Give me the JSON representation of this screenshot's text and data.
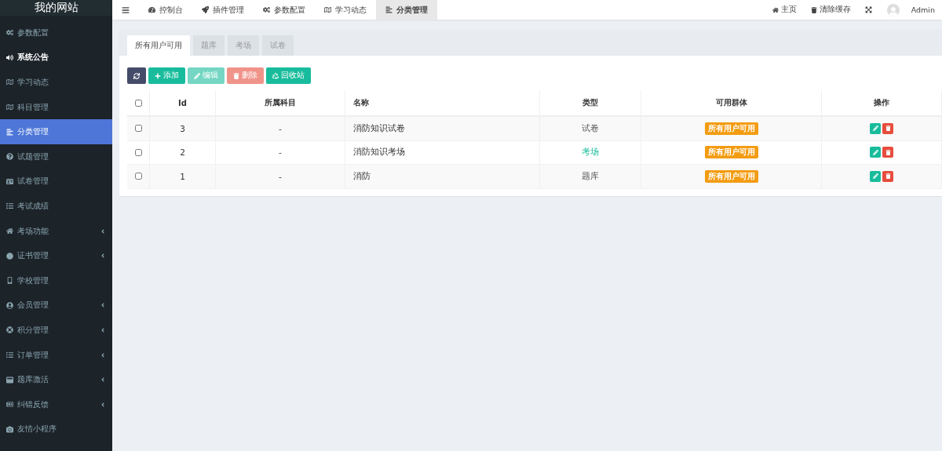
{
  "sidebar": {
    "title": "我的网站",
    "items": [
      {
        "label": "参数配置",
        "selected": false,
        "highlighted": false,
        "expandable": false
      },
      {
        "label": "系统公告",
        "selected": false,
        "highlighted": true,
        "expandable": false
      },
      {
        "label": "学习动态",
        "selected": false,
        "highlighted": false,
        "expandable": false
      },
      {
        "label": "科目管理",
        "selected": false,
        "highlighted": false,
        "expandable": false
      },
      {
        "label": "分类管理",
        "selected": true,
        "highlighted": false,
        "expandable": false
      },
      {
        "label": "试题管理",
        "selected": false,
        "highlighted": false,
        "expandable": false
      },
      {
        "label": "试卷管理",
        "selected": false,
        "highlighted": false,
        "expandable": false
      },
      {
        "label": "考试成绩",
        "selected": false,
        "highlighted": false,
        "expandable": false
      },
      {
        "label": "考场功能",
        "selected": false,
        "highlighted": false,
        "expandable": true
      },
      {
        "label": "证书管理",
        "selected": false,
        "highlighted": false,
        "expandable": true
      },
      {
        "label": "学校管理",
        "selected": false,
        "highlighted": false,
        "expandable": false
      },
      {
        "label": "会员管理",
        "selected": false,
        "highlighted": false,
        "expandable": true
      },
      {
        "label": "积分管理",
        "selected": false,
        "highlighted": false,
        "expandable": true
      },
      {
        "label": "订单管理",
        "selected": false,
        "highlighted": false,
        "expandable": true
      },
      {
        "label": "题库激活",
        "selected": false,
        "highlighted": false,
        "expandable": true
      },
      {
        "label": "纠错反馈",
        "selected": false,
        "highlighted": false,
        "expandable": true
      },
      {
        "label": "友情小程序",
        "selected": false,
        "highlighted": false,
        "expandable": false
      }
    ]
  },
  "topbar": {
    "tabs": [
      {
        "label": "控制台",
        "selected": false
      },
      {
        "label": "插件管理",
        "selected": false
      },
      {
        "label": "参数配置",
        "selected": false
      },
      {
        "label": "学习动态",
        "selected": false
      },
      {
        "label": "分类管理",
        "selected": true
      }
    ],
    "links": [
      {
        "label": "主页"
      },
      {
        "label": "清除缓存"
      }
    ],
    "user": "Admin"
  },
  "panel": {
    "tabs": [
      {
        "label": "所有用户可用",
        "selected": true
      },
      {
        "label": "题库",
        "selected": false
      },
      {
        "label": "考场",
        "selected": false
      },
      {
        "label": "试卷",
        "selected": false
      }
    ],
    "toolbar": [
      {
        "kind": "refresh",
        "disabled": false
      },
      {
        "kind": "add",
        "label": "添加",
        "disabled": false
      },
      {
        "kind": "edit",
        "label": "编辑",
        "disabled": true
      },
      {
        "kind": "delete",
        "label": "删除",
        "disabled": true
      },
      {
        "kind": "recycle",
        "label": "回收站",
        "disabled": false
      }
    ],
    "table": {
      "all_checked": false,
      "columns": [
        "Id",
        "所属科目",
        "名称",
        "类型",
        "可用群体",
        "操作"
      ],
      "rows": [
        {
          "checked": false,
          "id": "3",
          "subject": "-",
          "name": "消防知识试卷",
          "type": "试卷",
          "type_highlighted": false,
          "group": "所有用户可用"
        },
        {
          "checked": false,
          "id": "2",
          "subject": "-",
          "name": "消防知识考场",
          "type": "考场",
          "type_highlighted": true,
          "group": "所有用户可用"
        },
        {
          "checked": false,
          "id": "1",
          "subject": "-",
          "name": "消防",
          "type": "题库",
          "type_highlighted": false,
          "group": "所有用户可用"
        }
      ]
    }
  }
}
